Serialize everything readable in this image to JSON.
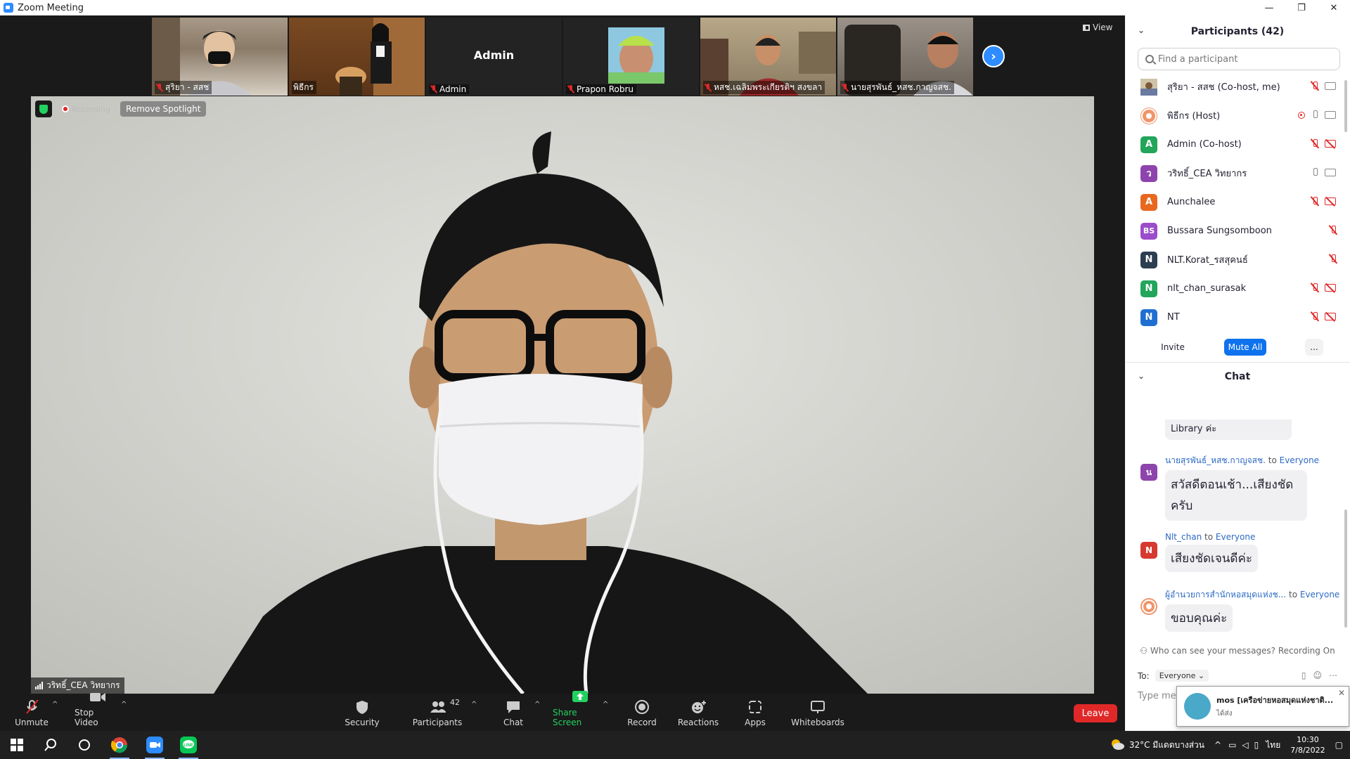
{
  "window": {
    "title": "Zoom Meeting",
    "controls": [
      "—",
      "❐",
      "✕"
    ]
  },
  "gallery": {
    "tiles": [
      {
        "name": "สุริยา - สสช",
        "muted": true,
        "bg": "#7a6a5a"
      },
      {
        "name": "พิธีกร",
        "muted": false,
        "bg": "#8a5a2a"
      },
      {
        "name": "Admin",
        "muted": true,
        "bg": "#232323",
        "display_name": "Admin"
      },
      {
        "name": "Prapon Robru",
        "muted": true,
        "bg": "#232323"
      },
      {
        "name": "หสช.เฉลิมพระเกียรติฯ สงขลา",
        "muted": true,
        "bg": "#9a8a72"
      },
      {
        "name": "นายสุรพันธ์_หสช.กาญจสช.",
        "muted": true,
        "bg": "#6a6258"
      }
    ],
    "view_label": "View"
  },
  "main_video": {
    "badges": {
      "recording": "Recording",
      "spotlight": "Remove Spotlight"
    },
    "speaker_label": "วริทธิ์_CEA วิทยากร"
  },
  "toolbar": {
    "unmute": "Unmute",
    "stop_video": "Stop Video",
    "security": "Security",
    "participants": "Participants",
    "participants_count": "42",
    "chat": "Chat",
    "share_screen": "Share Screen",
    "record": "Record",
    "reactions": "Reactions",
    "apps": "Apps",
    "whiteboards": "Whiteboards",
    "leave": "Leave"
  },
  "participants_panel": {
    "title": "Participants (42)",
    "search_placeholder": "Find a participant",
    "list": [
      {
        "name": "สุริยา - สสช (Co-host, me)",
        "initial": "",
        "color": "#b59a6a",
        "mic": "muted",
        "cam": "on",
        "rec": false
      },
      {
        "name": "พิธีกร (Host)",
        "initial": "",
        "color": "#f0956a",
        "mic": "on",
        "cam": "on",
        "rec": true
      },
      {
        "name": "Admin (Co-host)",
        "initial": "A",
        "color": "#23a55a",
        "mic": "muted",
        "cam": "muted",
        "rec": false
      },
      {
        "name": "วริทธิ์_CEA วิทยากร",
        "initial": "ว",
        "color": "#8e44ad",
        "mic": "on",
        "cam": "on",
        "rec": false
      },
      {
        "name": "Aunchalee",
        "initial": "A",
        "color": "#e8681e",
        "mic": "muted",
        "cam": "muted",
        "rec": false
      },
      {
        "name": "Bussara Sungsomboon",
        "initial": "BS",
        "color": "#9b4dca",
        "mic": "muted",
        "cam": "none",
        "rec": false
      },
      {
        "name": "NLT.Korat_รสสุคนธ์",
        "initial": "N",
        "color": "#2c3e50",
        "mic": "muted",
        "cam": "none",
        "rec": false
      },
      {
        "name": "nlt_chan_surasak",
        "initial": "N",
        "color": "#23a55a",
        "mic": "muted",
        "cam": "muted",
        "rec": false
      },
      {
        "name": "NT",
        "initial": "N",
        "color": "#1f6fd1",
        "mic": "muted",
        "cam": "muted",
        "rec": false
      }
    ],
    "invite": "Invite",
    "mute_all": "Mute All",
    "more": "..."
  },
  "chat_panel": {
    "title": "Chat",
    "messages": [
      {
        "sender": "",
        "to": "",
        "text": "Library ค่ะ",
        "avatar": "",
        "color": ""
      },
      {
        "sender": "นายสุรพันธ์_หสช.กาญจสช.",
        "to": "Everyone",
        "text": "สวัสดีตอนเช้า...เสียงชัดครับ",
        "avatar": "น",
        "color": "#8e44ad"
      },
      {
        "sender": "Nlt_chan",
        "to": "Everyone",
        "text": "เสียงชัดเจนดีค่ะ",
        "avatar": "N",
        "color": "#d63a2f"
      },
      {
        "sender": "ผู้อำนวยการสำนักหอสมุดแห่งช...",
        "to": "Everyone",
        "text": "ขอบคุณค่ะ",
        "avatar": "",
        "color": "#f0956a"
      }
    ],
    "to_word": "to",
    "who_can_see": "Who can see your messages? Recording On",
    "to_label": "To:",
    "to_value": "Everyone",
    "placeholder": "Type message here..."
  },
  "notification": {
    "title": "mos [เครือข่ายหอสมุดแห่งชาติ...",
    "subtitle": "ได้ส่ง"
  },
  "taskbar": {
    "weather": "32°C มีแดดบางส่วน",
    "lang": "ไทย",
    "time": "10:30",
    "date": "7/8/2022"
  }
}
